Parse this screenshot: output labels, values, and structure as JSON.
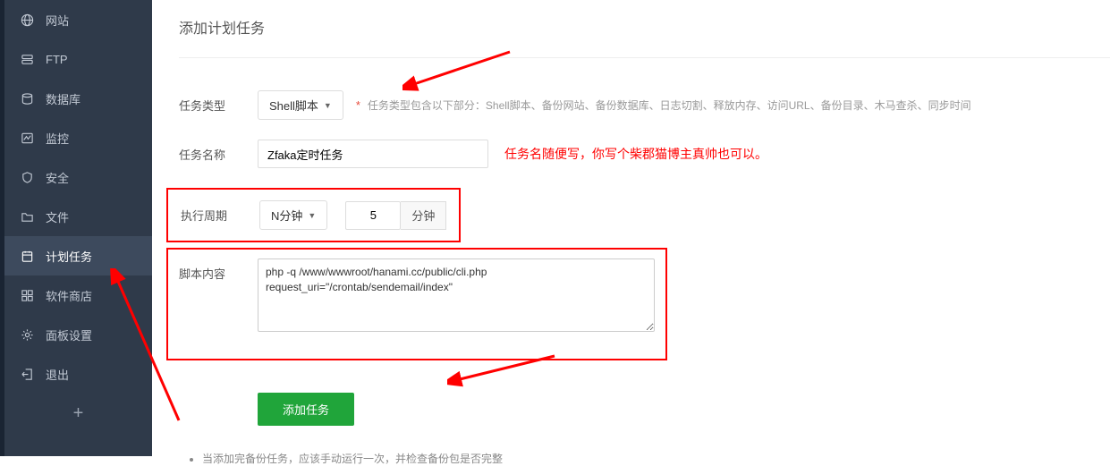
{
  "sidebar": {
    "items": [
      {
        "label": "网站",
        "icon": "globe"
      },
      {
        "label": "FTP",
        "icon": "ftp"
      },
      {
        "label": "数据库",
        "icon": "database"
      },
      {
        "label": "监控",
        "icon": "monitor"
      },
      {
        "label": "安全",
        "icon": "shield"
      },
      {
        "label": "文件",
        "icon": "folder"
      },
      {
        "label": "计划任务",
        "icon": "calendar"
      },
      {
        "label": "软件商店",
        "icon": "apps"
      },
      {
        "label": "面板设置",
        "icon": "gear"
      },
      {
        "label": "退出",
        "icon": "exit"
      }
    ]
  },
  "page": {
    "title": "添加计划任务"
  },
  "form": {
    "type_label": "任务类型",
    "type_value": "Shell脚本",
    "type_help": "任务类型包含以下部分：Shell脚本、备份网站、备份数据库、日志切割、释放内存、访问URL、备份目录、木马查杀、同步时间",
    "name_label": "任务名称",
    "name_value": "Zfaka定时任务",
    "name_annot": "任务名随便写，你写个柴郡猫博主真帅也可以。",
    "period_label": "执行周期",
    "period_mode": "N分钟",
    "period_value": "5",
    "period_unit": "分钟",
    "script_label": "脚本内容",
    "script_value": "php -q /www/wwwroot/hanami.cc/public/cli.php request_uri=\"/crontab/sendemail/index\"",
    "submit_label": "添加任务"
  },
  "tips": {
    "t1": "当添加完备份任务，应该手动运行一次，并检查备份包是否完整"
  }
}
